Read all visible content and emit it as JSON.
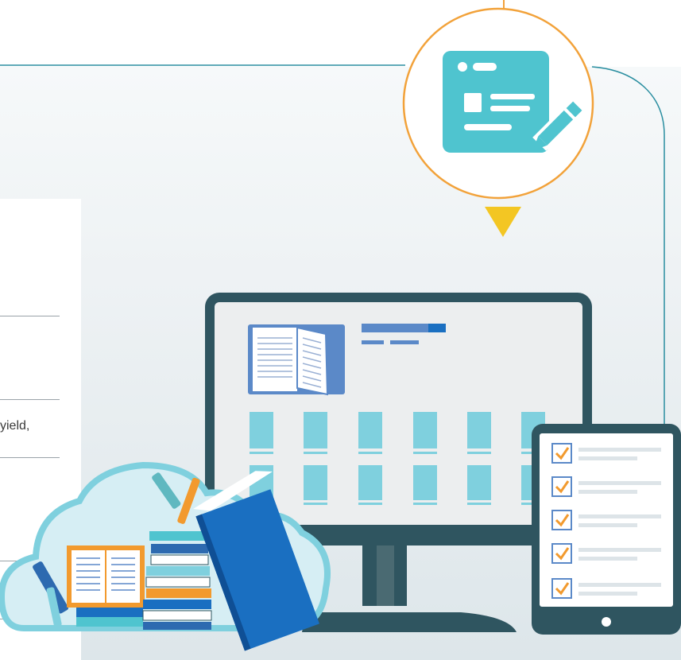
{
  "card": {
    "clipped_text": "yield,"
  },
  "colors": {
    "teal_line": "#2a8ea0",
    "orange_ring": "#f2a23a",
    "yellow_arrow": "#f3c623",
    "form_icon": "#4fc4cf",
    "monitor_frame": "#2f5560",
    "book_blue": "#1a6fc1",
    "check_orange": "#f29a2e"
  },
  "icons": {
    "form_edit": "form-edit-icon",
    "arrow": "triangle-down-icon",
    "checklist_item": "checkbox-checked-icon"
  }
}
